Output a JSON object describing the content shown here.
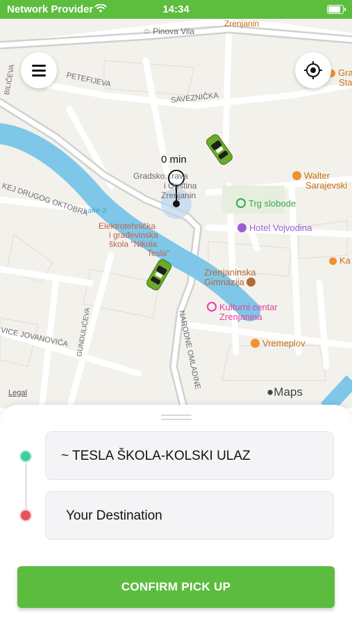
{
  "status_bar": {
    "provider": "Network Provider",
    "time": "14:34"
  },
  "map": {
    "streets": [
      "Pinova Vila",
      "Zrenjanin",
      "PETEFIJEVA",
      "SAVEZNIČKA",
      "BILIČEVA",
      "KEJ DRUGOG OKTOBRA",
      "GUNDULIĆEVA",
      "VICE JOVANOVIĆA",
      "NARODNE OMLADINE",
      "Lake 3",
      "Gradsko...rava",
      "i Opština",
      "Zrenjanin"
    ],
    "pois": [
      {
        "label": "Trg slobode",
        "color": "#34a853"
      },
      {
        "label": "Hotel Vojvodina",
        "color": "#9a5fd6"
      },
      {
        "label": "Elektrotehnička",
        "color": "#c0624a"
      },
      {
        "label": "i građevinska",
        "color": "#c0624a"
      },
      {
        "label": "škola \"Nikola",
        "color": "#c0624a"
      },
      {
        "label": "Tesla\"",
        "color": "#c0624a"
      },
      {
        "label": "Zrenjaninska",
        "color": "#b06a3a"
      },
      {
        "label": "Gimnazija",
        "color": "#b06a3a"
      },
      {
        "label": "Kulturni centar",
        "color": "#e040a0"
      },
      {
        "label": "Zrenjanina",
        "color": "#e040a0"
      },
      {
        "label": "Vremeplov",
        "color": "#c57012"
      },
      {
        "label": "Walter",
        "color": "#c57012"
      },
      {
        "label": "Sarajevski",
        "color": "#c57012"
      },
      {
        "label": "Gra",
        "color": "#c57012"
      },
      {
        "label": "Sta",
        "color": "#c57012"
      },
      {
        "label": "Ka",
        "color": "#c57012"
      }
    ],
    "eta": "0 min",
    "legal": "Legal",
    "maps_brand": "Maps"
  },
  "sheet": {
    "pickup_value": "~ TESLA ŠKOLA-KOLSKI ULAZ",
    "destination_placeholder": "Your Destination",
    "confirm_label": "CONFIRM PICK UP",
    "pickup_color": "#3ecfa0",
    "destination_color": "#e8505b"
  },
  "battery_level": 0.92,
  "accent_color": "#5dbd3f"
}
